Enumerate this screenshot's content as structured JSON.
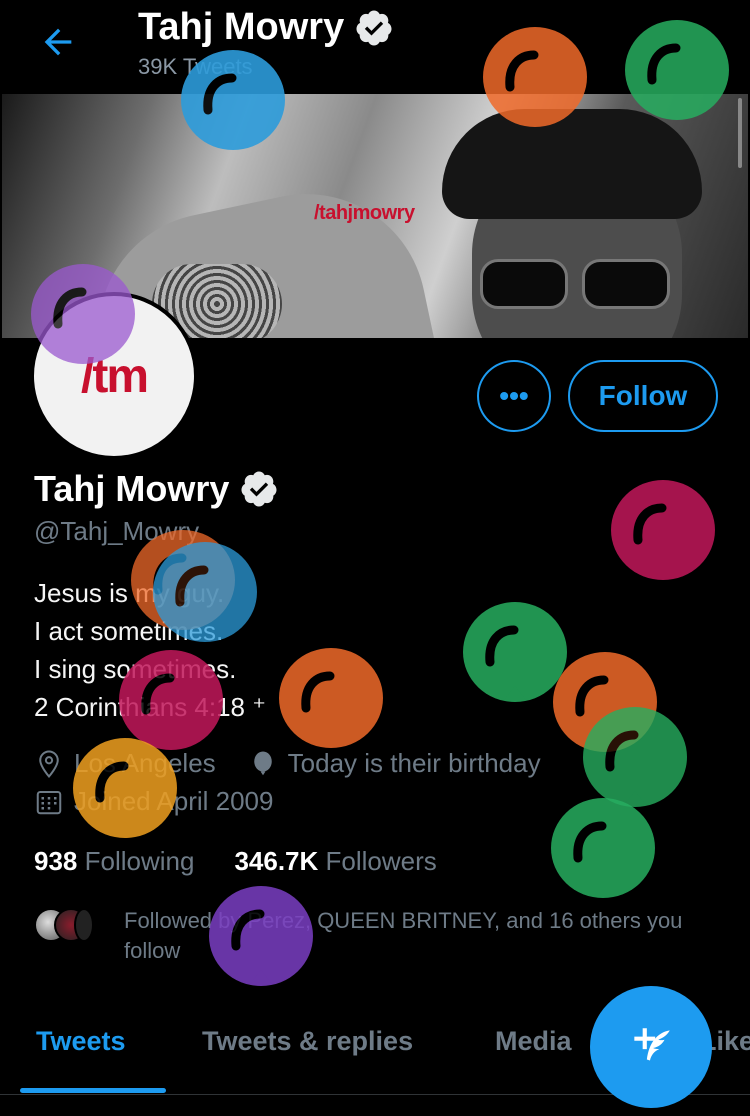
{
  "header": {
    "title": "Tahj Mowry",
    "tweet_count": "39K Tweets",
    "back_icon": "back-arrow-icon"
  },
  "banner": {
    "brand_text": "/tahjmowry"
  },
  "avatar": {
    "text": "/tm"
  },
  "actions": {
    "more_label": "•••",
    "follow_label": "Follow"
  },
  "profile": {
    "name": "Tahj Mowry",
    "handle": "@Tahj_Mowry",
    "bio_lines": [
      "Jesus is my guy.",
      "I act sometimes.",
      "I sing sometimes.",
      "2 Corinthians 4:18 ⁺"
    ],
    "location": "Los Angeles",
    "birthday": "Today is their birthday",
    "joined": "Joined April 2009"
  },
  "stats": {
    "following_count": "938",
    "following_label": "Following",
    "followers_count": "346.7K",
    "followers_label": "Followers"
  },
  "followed_by": {
    "text": "Followed by Perez, QUEEN BRITNEY, and 16 others you follow"
  },
  "tabs": [
    "Tweets",
    "Tweets & replies",
    "Media",
    "Likes"
  ],
  "colors": {
    "accent": "#1d9bf0",
    "brand_red": "#c8102e"
  },
  "balloons": [
    {
      "color": "#2d9cdb"
    },
    {
      "color": "#f06a2a"
    },
    {
      "color": "#27ae60"
    },
    {
      "color": "#9b59d0"
    },
    {
      "color": "#c2185b"
    },
    {
      "color": "#f06a2a"
    },
    {
      "color": "#2d9cdb"
    },
    {
      "color": "#27ae60"
    },
    {
      "color": "#f06a2a"
    },
    {
      "color": "#c2185b"
    },
    {
      "color": "#f0a020"
    },
    {
      "color": "#f06a2a"
    },
    {
      "color": "#27ae60"
    },
    {
      "color": "#27ae60"
    },
    {
      "color": "#7b3fc4"
    }
  ]
}
